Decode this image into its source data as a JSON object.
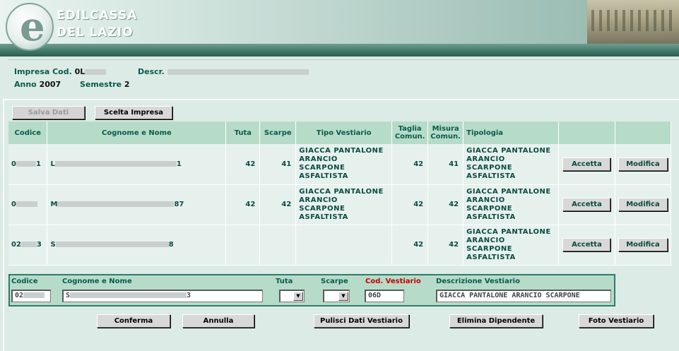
{
  "header": {
    "brand_line1": "EDILCASSA",
    "brand_line2": "DEL LAZIO"
  },
  "info": {
    "impresa_label": "Impresa Cod.",
    "impresa_value": "0L",
    "descr_label": "Descr.",
    "descr_value": "",
    "anno_label": "Anno",
    "anno_value": "2007",
    "semestre_label": "Semestre",
    "semestre_value": "2"
  },
  "toolbar": {
    "salva_label": "Salva Dati",
    "scelta_label": "Scelta Impresa"
  },
  "table": {
    "headers": {
      "codice": "Codice",
      "nome": "Cognome e Nome",
      "tuta": "Tuta",
      "scarpe": "Scarpe",
      "tipo": "Tipo Vestiario",
      "taglia": "Taglia Comun.",
      "misura": "Misura Comun.",
      "tipologia": "Tipologia"
    },
    "rows": [
      {
        "codice_start": "0",
        "codice_end": "1",
        "nome_start": "L",
        "nome_end": "1",
        "tuta": "42",
        "scarpe": "41",
        "tipo": [
          "GIACCA PANTALONE",
          "ARANCIO",
          "SCARPONE",
          "ASFALTISTA"
        ],
        "taglia": "42",
        "misura": "41",
        "tipologia": [
          "GIACCA PANTALONE",
          "ARANCIO",
          "SCARPONE",
          "ASFALTISTA"
        ],
        "accetta": "Accetta",
        "modifica": "Modifica"
      },
      {
        "codice_start": "0",
        "codice_end": "",
        "nome_start": "M",
        "nome_end": "87",
        "tuta": "42",
        "scarpe": "42",
        "tipo": [
          "GIACCA PANTALONE",
          "ARANCIO",
          "SCARPONE",
          "ASFALTISTA"
        ],
        "taglia": "42",
        "misura": "42",
        "tipologia": [
          "GIACCA PANTALONE",
          "ARANCIO",
          "SCARPONE",
          "ASFALTISTA"
        ],
        "accetta": "Accetta",
        "modifica": "Modifica"
      },
      {
        "codice_start": "02",
        "codice_end": "3",
        "nome_start": "S",
        "nome_end": "8",
        "tuta": "",
        "scarpe": "",
        "tipo": [
          "",
          "",
          "",
          ""
        ],
        "taglia": "42",
        "misura": "42",
        "tipologia": [
          "GIACCA PANTALONE",
          "ARANCIO",
          "SCARPONE",
          "ASFALTISTA"
        ],
        "accetta": "Accetta",
        "modifica": "Modifica"
      }
    ]
  },
  "form": {
    "codice_label": "Codice",
    "codice_value": "02",
    "nome_label": "Cognome e Nome",
    "nome_value": "S",
    "nome_end": "3",
    "tuta_label": "Tuta",
    "scarpe_label": "Scarpe",
    "cod_vest_label": "Cod. Vestiario",
    "cod_vest_value": "06D",
    "descr_vest_label": "Descrizione Vestiario",
    "descr_vest_value": "GIACCA PANTALONE ARANCIO SCARPONE"
  },
  "actions": {
    "conferma": "Conferma",
    "annulla": "Annulla",
    "pulisci": "Pulisci Dati Vestiario",
    "elimina": "Elimina Dipendente",
    "foto": "Foto Vestiario"
  },
  "colors": {
    "accent": "#0b5a4c",
    "header_bg": "#b6dcc9",
    "required_label": "#c40000"
  }
}
